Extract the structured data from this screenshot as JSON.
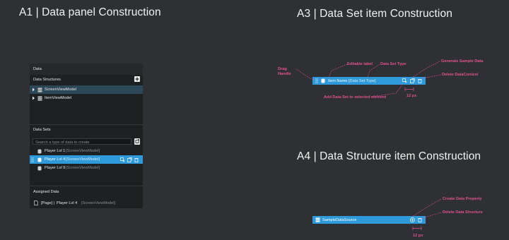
{
  "titles": {
    "a1": "A1 | Data panel Construction",
    "a3": "A3 | Data Set item Construction",
    "a4": "A4 | Data Structure item Construction"
  },
  "panel": {
    "header": "Data",
    "structures": {
      "label": "Data Structures",
      "items": [
        "ScreenViewModel",
        "ItemViewModel"
      ]
    },
    "datasets": {
      "label": "Data Sets",
      "search_placeholder": "Search a type of data to create",
      "items": [
        {
          "name": "Player Lvl 1",
          "type": "[ScreenViewModel]"
        },
        {
          "name": "Player Lvl 4",
          "type": "[ScreenViewModel]"
        },
        {
          "name": "Player Lvl 9",
          "type": "[ScreenViewModel]"
        }
      ]
    },
    "assigned": {
      "label": "Assigned Data",
      "page": "[Page]",
      "sep": "|",
      "name": "Player Lvl 4",
      "type": "[ScreenViewModel]"
    }
  },
  "a3": {
    "item_name": "Item Name",
    "item_type": "[Data Set Type]",
    "callouts": {
      "drag_handle": "Drag Handle",
      "editable_label": "Editable label",
      "data_set_type": "Data Set Type",
      "generate_sample": "Generate Sample Data",
      "delete_context": "Delete DataContext",
      "add_data_set": "Add Data Set to selected element",
      "spacing": "12 px"
    }
  },
  "a4": {
    "item_name": "SampleDataSource",
    "callouts": {
      "create_property": "Create Data Property",
      "delete_structure": "Delete Data Structure",
      "spacing": "12 px"
    }
  },
  "colors": {
    "background": "#2e3033",
    "panel": "#1f2022",
    "accent_blue": "#2f9ad9",
    "selected_row": "#2c4757",
    "callout": "#e0528f"
  },
  "icons": [
    "plus-icon",
    "chevron-right-icon",
    "structure-icon",
    "database-icon",
    "create-dataset-icon",
    "add-to-element-icon",
    "generate-sample-icon",
    "delete-icon",
    "drag-handle-icon",
    "document-icon",
    "add-circle-icon"
  ]
}
